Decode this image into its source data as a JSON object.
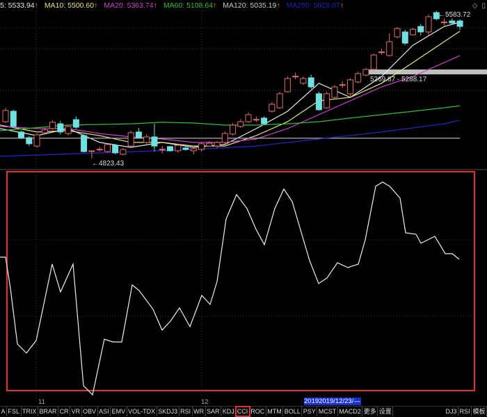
{
  "header": {
    "ma_items": [
      {
        "label": "5: 5533.94",
        "color": "#e8e8e8"
      },
      {
        "label": "MA10: 5500.60",
        "color": "#e6e67a"
      },
      {
        "label": "MA20: 5363.74",
        "color": "#d040d0"
      },
      {
        "label": "MA60: 5108.64",
        "color": "#30c030"
      },
      {
        "label": "MA120: 5035.19",
        "color": "#c8c8c8"
      },
      {
        "label": "MA250: 5028.07",
        "color": "#2020c0"
      }
    ],
    "arrow": "↑",
    "icons": [
      "diamond-icon",
      "window-icon"
    ]
  },
  "chart_data": {
    "type": "candlestick",
    "up_color": "#e07070",
    "down_color": "#70e0e0",
    "candles_ochl_note_order": "open,close,high,low",
    "candles": [
      [
        5017,
        5076,
        5090,
        5010
      ],
      [
        5072,
        4992,
        5080,
        4985
      ],
      [
        4963,
        4933,
        4970,
        4926
      ],
      [
        4933,
        4901,
        4940,
        4890
      ],
      [
        4889,
        4948,
        4955,
        4880
      ],
      [
        4959,
        4974,
        4985,
        4952
      ],
      [
        4981,
        5014,
        5025,
        4975
      ],
      [
        5006,
        4963,
        5020,
        4950
      ],
      [
        4955,
        4992,
        5000,
        4945
      ],
      [
        5028,
        4988,
        5045,
        4980
      ],
      [
        4944,
        4860,
        4950,
        4855
      ],
      [
        4860,
        4864,
        4866,
        4824
      ],
      [
        4871,
        4872,
        4885,
        4860
      ],
      [
        4860,
        4897,
        4905,
        4855
      ],
      [
        4893,
        4853,
        4900,
        4846
      ],
      [
        4846,
        4871,
        4880,
        4840
      ],
      [
        4889,
        4959,
        4970,
        4885
      ],
      [
        4963,
        4933,
        4985,
        4930
      ],
      [
        4908,
        4937,
        4950,
        4900
      ],
      [
        4937,
        4889,
        5006,
        4860
      ],
      [
        4871,
        4872,
        4890,
        4850
      ],
      [
        4886,
        4864,
        4890,
        4860
      ],
      [
        4864,
        4893,
        4900,
        4855
      ],
      [
        4879,
        4871,
        4885,
        4865
      ],
      [
        4864,
        4875,
        4885,
        4845
      ],
      [
        4871,
        4901,
        4908,
        4860
      ],
      [
        4889,
        4904,
        4915,
        4885
      ],
      [
        4889,
        4908,
        4915,
        4880
      ],
      [
        4908,
        4955,
        4965,
        4900
      ],
      [
        4952,
        4999,
        5010,
        4945
      ],
      [
        4992,
        5017,
        5030,
        4985
      ],
      [
        5017,
        5054,
        5065,
        5010
      ],
      [
        5028,
        5029,
        5045,
        5015
      ],
      [
        5036,
        5006,
        5045,
        5000
      ],
      [
        5072,
        5109,
        5120,
        5065
      ],
      [
        5090,
        5164,
        5175,
        5085
      ],
      [
        5175,
        5244,
        5255,
        5170
      ],
      [
        5255,
        5256,
        5275,
        5240
      ],
      [
        5219,
        5244,
        5255,
        5210
      ],
      [
        5248,
        5200,
        5265,
        5190
      ],
      [
        5164,
        5080,
        5175,
        5075
      ],
      [
        5090,
        5164,
        5175,
        5085
      ],
      [
        5145,
        5200,
        5210,
        5140
      ],
      [
        5211,
        5212,
        5230,
        5195
      ],
      [
        5164,
        5237,
        5245,
        5150
      ],
      [
        5226,
        5270,
        5280,
        5220
      ],
      [
        5262,
        5292,
        5300,
        5255
      ],
      [
        5292,
        5368,
        5375,
        5285
      ],
      [
        5383,
        5384,
        5400,
        5370
      ],
      [
        5365,
        5438,
        5482,
        5360
      ],
      [
        5463,
        5507,
        5515,
        5455
      ],
      [
        5489,
        5430,
        5500,
        5420
      ],
      [
        5474,
        5503,
        5510,
        5470
      ],
      [
        5518,
        5489,
        5530,
        5470
      ],
      [
        5489,
        5569,
        5580,
        5470
      ],
      [
        5591,
        5558,
        5600,
        5550
      ],
      [
        5540,
        5541,
        5560,
        5525
      ],
      [
        5547,
        5536,
        5560,
        5530
      ],
      [
        5547,
        5518,
        5555,
        5500
      ]
    ],
    "ma_series": [
      {
        "name": "MA5",
        "color": "#e8e8e8",
        "idx": [
          0,
          4,
          8,
          12,
          16,
          20,
          24,
          28,
          32,
          36,
          40,
          44,
          48,
          52,
          56,
          58
        ],
        "values": [
          4981,
          4944,
          4981,
          4908,
          4882,
          4908,
          4882,
          4897,
          4981,
          5072,
          5219,
          5145,
          5255,
          5419,
          5518,
          5540
        ]
      },
      {
        "name": "MA10",
        "color": "#e6e67a",
        "idx": [
          0,
          4,
          8,
          12,
          16,
          20,
          24,
          28,
          32,
          36,
          40,
          44,
          48,
          52,
          56,
          58
        ],
        "values": [
          4999,
          4963,
          4970,
          4944,
          4908,
          4908,
          4889,
          4889,
          4944,
          5017,
          5127,
          5145,
          5219,
          5328,
          5438,
          5493
        ]
      },
      {
        "name": "MA20",
        "color": "#d040d0",
        "idx": [
          0,
          4,
          8,
          12,
          16,
          20,
          24,
          28,
          32,
          36,
          40,
          44,
          48,
          52,
          56,
          58
        ],
        "values": [
          4992,
          4981,
          4981,
          4955,
          4937,
          4926,
          4908,
          4908,
          4926,
          4981,
          5054,
          5127,
          5200,
          5255,
          5328,
          5365
        ]
      },
      {
        "name": "MA60",
        "color": "#30c030",
        "idx": [
          0,
          8,
          16,
          20,
          24,
          28,
          32,
          36,
          40,
          44,
          48,
          52,
          56,
          58
        ],
        "values": [
          4970,
          4999,
          5006,
          5014,
          5010,
          4999,
          4999,
          5006,
          5017,
          5036,
          5054,
          5072,
          5090,
          5101
        ]
      },
      {
        "name": "MA120",
        "color": "#b0b0b0",
        "idx": [
          0,
          58
        ],
        "values": [
          4930,
          4930
        ]
      },
      {
        "name": "MA250",
        "color": "#2828c8",
        "idx": [
          0,
          12,
          24,
          32,
          40,
          48,
          56,
          58
        ],
        "values": [
          4835,
          4853,
          4871,
          4889,
          4926,
          4963,
          5006,
          5025
        ]
      }
    ],
    "annotations": {
      "high": "5583.72",
      "low": "4823.43",
      "range": "5269.87 - 5288.17"
    },
    "indicator": {
      "name": "CCI",
      "color": "#f0f0f0",
      "box_color": "#e03030",
      "values": [
        30,
        30,
        -15,
        -95,
        -108,
        -90,
        20,
        -20,
        20,
        -155,
        -168,
        -88,
        -92,
        -92,
        -10,
        -18,
        -45,
        -75,
        -62,
        -43,
        -70,
        -25,
        -38,
        -5,
        85,
        120,
        100,
        70,
        48,
        100,
        128,
        110,
        25,
        -8,
        0,
        22,
        15,
        20,
        55,
        132,
        138,
        132,
        115,
        65,
        63,
        50,
        60,
        35,
        35,
        27
      ]
    },
    "x_labels": [
      "11",
      "12"
    ],
    "cursor_date": "20192019/12/23/—"
  },
  "tabs": [
    {
      "label": "A"
    },
    {
      "label": "FSL"
    },
    {
      "label": "TRIX"
    },
    {
      "label": "BRAR"
    },
    {
      "label": "CR"
    },
    {
      "label": "VR"
    },
    {
      "label": "OBV"
    },
    {
      "label": "ASI"
    },
    {
      "label": "EMV"
    },
    {
      "label": "VOL-TDX"
    },
    {
      "label": "SKDJ3"
    },
    {
      "label": "RSI"
    },
    {
      "label": "WR"
    },
    {
      "label": "SAR"
    },
    {
      "label": "KDJ"
    },
    {
      "label": "CCI",
      "selected": true
    },
    {
      "label": "ROC"
    },
    {
      "label": "MTM"
    },
    {
      "label": "BOLL"
    },
    {
      "label": "PSY"
    },
    {
      "label": "MCST"
    },
    {
      "label": "MACD2"
    },
    {
      "label": "更多"
    },
    {
      "label": "设置"
    },
    {
      "label": "DJ3"
    },
    {
      "label": "RSI"
    },
    {
      "label": "模板"
    }
  ]
}
